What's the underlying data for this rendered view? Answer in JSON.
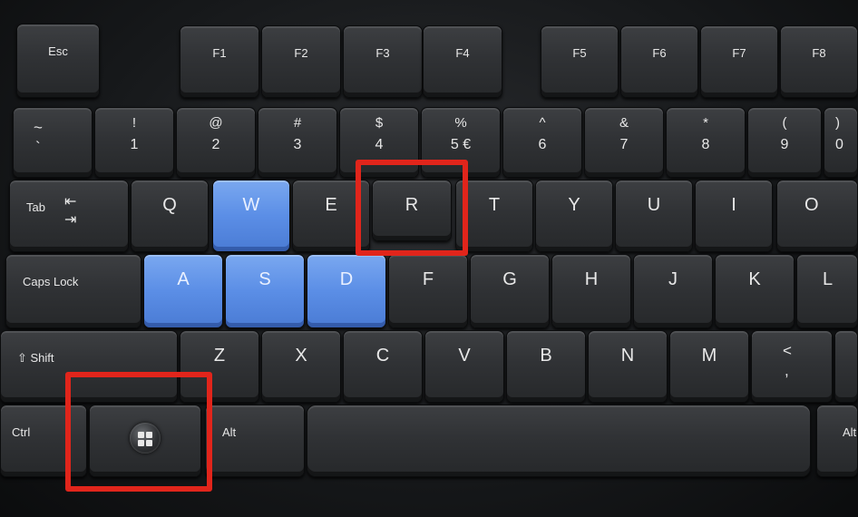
{
  "keys": {
    "esc": "Esc",
    "f1": "F1",
    "f2": "F2",
    "f3": "F3",
    "f4": "F4",
    "f5": "F5",
    "f6": "F6",
    "f7": "F7",
    "f8": "F8",
    "tilde_top": "~",
    "tilde_bot": "`",
    "n1_top": "!",
    "n1_bot": "1",
    "n2_top": "@",
    "n2_bot": "2",
    "n3_top": "#",
    "n3_bot": "3",
    "n4_top": "$",
    "n4_bot": "4",
    "n5_top": "%",
    "n5_bot": "5 €",
    "n6_top": "^",
    "n6_bot": "6",
    "n7_top": "&",
    "n7_bot": "7",
    "n8_top": "*",
    "n8_bot": "8",
    "n9_top": "(",
    "n9_bot": "9",
    "n0_top": ")",
    "n0_bot": "0",
    "tab": "Tab",
    "tab_arrows": "⇤ ⇥",
    "q": "Q",
    "w": "W",
    "e": "E",
    "r": "R",
    "t": "T",
    "y": "Y",
    "u": "U",
    "i": "I",
    "o": "O",
    "caps": "Caps Lock",
    "a": "A",
    "s": "S",
    "d": "D",
    "f": "F",
    "g": "G",
    "h": "H",
    "j": "J",
    "k": "K",
    "l": "L",
    "shift": "⇧ Shift",
    "z": "Z",
    "x": "X",
    "c": "C",
    "v": "V",
    "b": "B",
    "n": "N",
    "m": "M",
    "comma_top": "<",
    "comma_bot": ",",
    "ctrl": "Ctrl",
    "alt": "Alt",
    "alt_right": "Alt"
  },
  "highlighted_keys": [
    "R",
    "Windows"
  ],
  "highlight_color": "#e1251b",
  "blue_keys": [
    "W",
    "A",
    "S",
    "D"
  ],
  "blue_color": "#5b8ee6"
}
